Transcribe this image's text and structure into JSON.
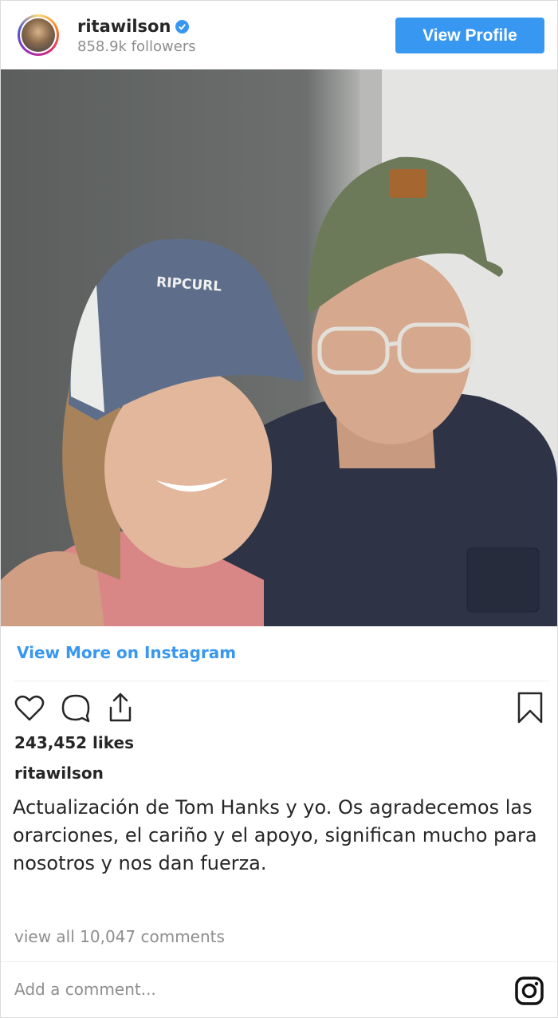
{
  "header": {
    "username": "ritawilson",
    "followers": "858.9k followers",
    "view_profile_label": "View Profile"
  },
  "photo": {
    "cap_text": "RIPCURL"
  },
  "view_more_label": "View More on Instagram",
  "post": {
    "likes": "243,452 likes",
    "caption_user": "ritawilson",
    "caption_text": "Actualización de Tom Hanks y yo. Os agradecemos las orarciones, el cariño y el apoyo, significan mucho para nosotros y nos dan fuerza.",
    "view_comments": "view all 10,047 comments"
  },
  "comment_input": {
    "placeholder": "Add a comment..."
  },
  "colors": {
    "accent": "#3897f0",
    "muted_text": "#8e8e8e",
    "primary_text": "#262626"
  },
  "icons": [
    "verified-badge-icon",
    "heart-icon",
    "comment-icon",
    "share-icon",
    "bookmark-icon",
    "instagram-logo-icon"
  ]
}
